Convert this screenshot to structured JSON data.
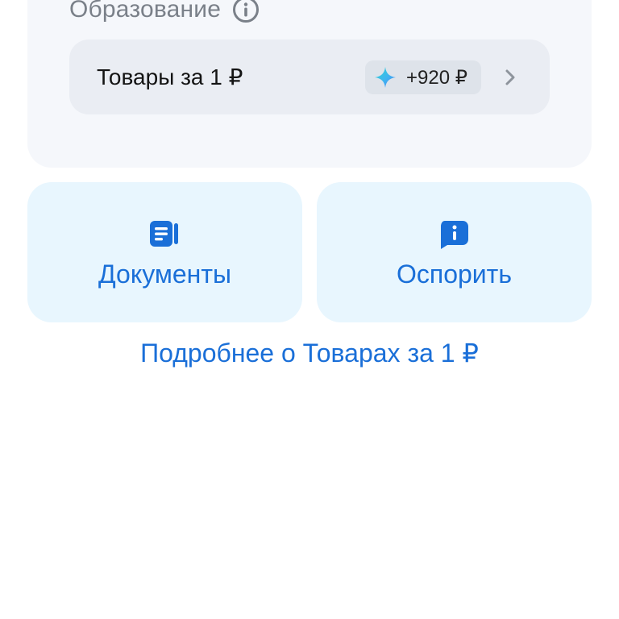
{
  "section": {
    "title": "Образование",
    "info_icon": "info-icon"
  },
  "promo": {
    "label": "Товары за 1 ₽",
    "bonus": "+920 ₽",
    "bonus_icon": "sparkle-icon",
    "chevron_icon": "chevron-right-icon"
  },
  "actions": {
    "documents": {
      "label": "Документы",
      "icon": "document-list-icon"
    },
    "dispute": {
      "label": "Оспорить",
      "icon": "info-chat-icon"
    }
  },
  "more_link": "Подробнее о Товарах за 1 ₽",
  "colors": {
    "accent": "#1a6fd8",
    "tile_bg": "#e8f6fe",
    "card_bg": "#f5f7fb",
    "row_bg": "#eaedf3",
    "muted_text": "#7a8089"
  }
}
